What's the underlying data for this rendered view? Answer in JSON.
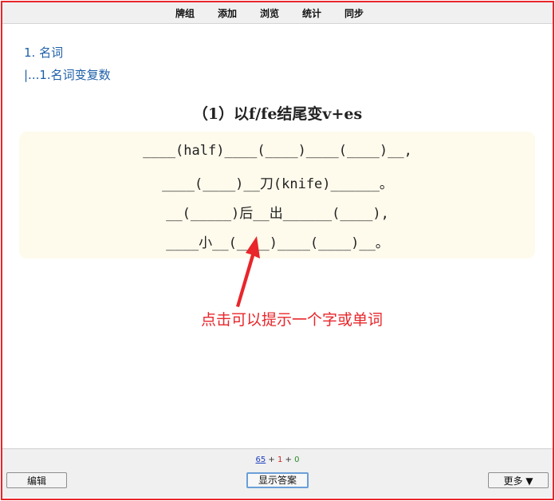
{
  "topbar": {
    "items": [
      {
        "label": "牌组"
      },
      {
        "label": "添加"
      },
      {
        "label": "浏览"
      },
      {
        "label": "统计"
      },
      {
        "label": "同步"
      }
    ]
  },
  "breadcrumb": {
    "level1": "1. 名词",
    "level2": "|...1.名词变复数"
  },
  "card": {
    "title": "（1）以f/fe结尾变v+es",
    "lines": [
      "____(half)____(____)____(____)__,",
      "____(____)__刀(knife)______。",
      "__(_____)后__出______(____),",
      "____小__(____)____(____)__。"
    ]
  },
  "annotation": {
    "caption": "点击可以提示一个字或单词",
    "color": "#e8262b"
  },
  "bottombar": {
    "stats": {
      "new": "65",
      "sep1": " + ",
      "learn": "1",
      "sep2": " + ",
      "review": "0"
    },
    "edit_label": "编辑",
    "show_answer_label": "显示答案",
    "more_label": "更多 ▼"
  }
}
